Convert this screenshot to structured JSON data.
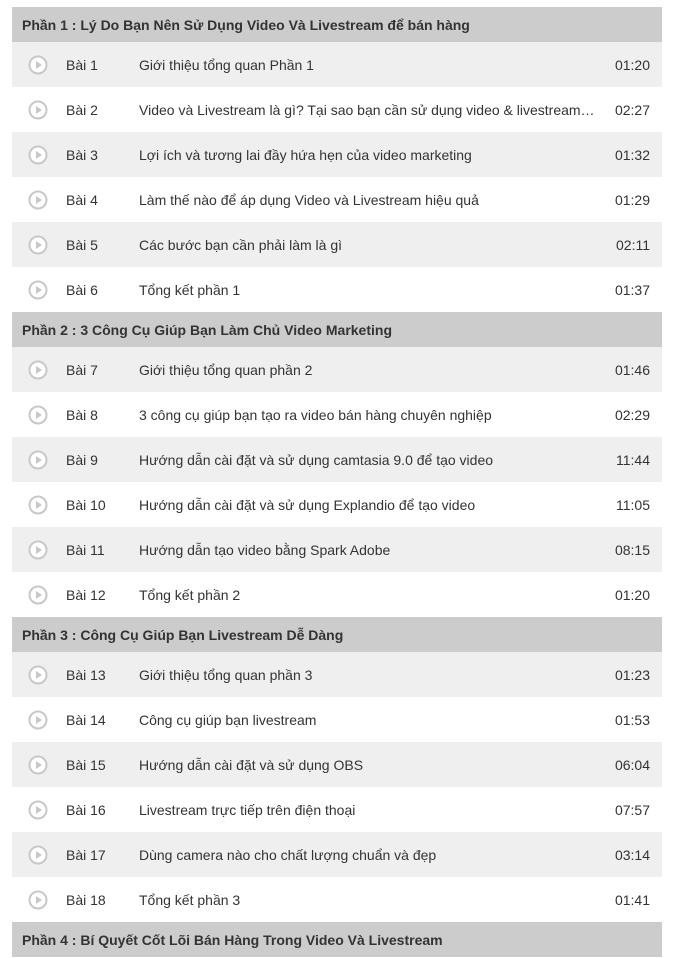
{
  "sections": [
    {
      "title": "Phần 1 : Lý Do Bạn Nên Sử Dụng Video Và Livestream để bán hàng",
      "lessons": [
        {
          "num": "Bài 1",
          "title": "Giới thiệu tổng quan Phần 1",
          "time": "01:20"
        },
        {
          "num": "Bài 2",
          "title": "Video và Livestream là gì? Tại sao bạn cần sử dụng video & livestream…",
          "time": "02:27"
        },
        {
          "num": "Bài 3",
          "title": "Lợi ích và tương lai đầy hứa hẹn của video marketing",
          "time": "01:32"
        },
        {
          "num": "Bài 4",
          "title": "Làm thế nào để áp dụng Video và Livestream hiệu quả",
          "time": "01:29"
        },
        {
          "num": "Bài 5",
          "title": "Các bước bạn cần phải làm là gì",
          "time": "02:11"
        },
        {
          "num": "Bài 6",
          "title": "Tổng kết phần 1",
          "time": "01:37"
        }
      ]
    },
    {
      "title": "Phần 2 : 3 Công Cụ Giúp Bạn Làm Chủ Video Marketing",
      "lessons": [
        {
          "num": "Bài 7",
          "title": "Giới thiệu tổng quan phần 2",
          "time": "01:46"
        },
        {
          "num": "Bài 8",
          "title": "3 công cụ giúp bạn tạo ra video bán hàng chuyên nghiệp",
          "time": "02:29"
        },
        {
          "num": "Bài 9",
          "title": "Hướng dẫn cài đặt và sử dụng camtasia 9.0 để tạo video",
          "time": "11:44"
        },
        {
          "num": "Bài 10",
          "title": "Hướng dẫn cài đặt và sử dụng Explandio để tạo video",
          "time": "11:05"
        },
        {
          "num": "Bài 11",
          "title": "Hướng dẫn tạo video bằng Spark Adobe",
          "time": "08:15"
        },
        {
          "num": "Bài 12",
          "title": "Tổng kết phần 2",
          "time": "01:20"
        }
      ]
    },
    {
      "title": "Phần 3 : Công Cụ Giúp Bạn Livestream Dễ Dàng",
      "lessons": [
        {
          "num": "Bài 13",
          "title": "Giới thiệu tổng quan phần 3",
          "time": "01:23"
        },
        {
          "num": "Bài 14",
          "title": "Công cụ giúp bạn livestream",
          "time": "01:53"
        },
        {
          "num": "Bài 15",
          "title": "Hướng dẫn cài đặt và sử dụng OBS",
          "time": "06:04"
        },
        {
          "num": "Bài 16",
          "title": "Livestream trực tiếp trên điện thoại",
          "time": "07:57"
        },
        {
          "num": "Bài 17",
          "title": "Dùng camera nào cho chất lượng chuẩn và đẹp",
          "time": "03:14"
        },
        {
          "num": "Bài 18",
          "title": "Tổng kết phần 3",
          "time": "01:41"
        }
      ]
    },
    {
      "title": "Phần 4 : Bí Quyết Cốt Lõi Bán Hàng Trong Video Và Livestream",
      "lessons": []
    }
  ],
  "icons": {
    "lesson": "play-circle-icon"
  },
  "colors": {
    "section_bg": "#cccccc",
    "row_odd_bg": "#efefef",
    "row_even_bg": "#ffffff",
    "text": "#333333",
    "icon": "#c8c8c8"
  }
}
